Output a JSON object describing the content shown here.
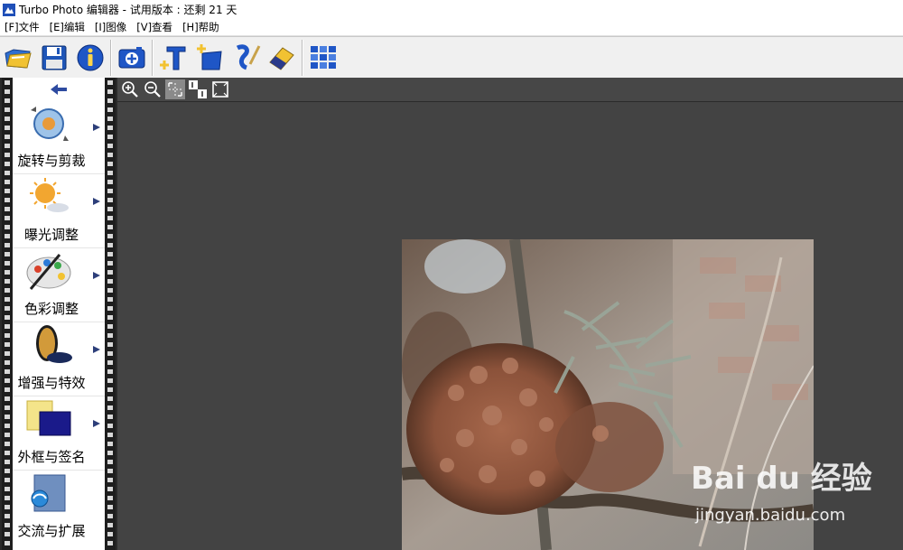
{
  "window": {
    "title": "Turbo Photo 编辑器 - 试用版本 : 还剩 21 天"
  },
  "menu": {
    "items": [
      {
        "label": "[F]文件"
      },
      {
        "label": "[E]编辑"
      },
      {
        "label": "[I]图像"
      },
      {
        "label": "[V]查看"
      },
      {
        "label": "[H]帮助"
      }
    ]
  },
  "toolbar": {
    "buttons": [
      {
        "icon": "open-folder-icon"
      },
      {
        "icon": "save-disk-icon"
      },
      {
        "icon": "info-icon"
      },
      {
        "icon": "add-photo-icon"
      },
      {
        "icon": "add-text-icon"
      },
      {
        "icon": "add-frame-icon"
      },
      {
        "icon": "brush-icon"
      },
      {
        "icon": "eraser-icon"
      },
      {
        "icon": "batch-grid-icon"
      }
    ]
  },
  "sidebar": {
    "back_icon": "back-arrow-icon",
    "tools": [
      {
        "label": "旋转与剪裁",
        "icon": "rotate-crop-icon",
        "has_submenu": true
      },
      {
        "label": "曝光调整",
        "icon": "exposure-sun-icon",
        "has_submenu": true
      },
      {
        "label": "色彩调整",
        "icon": "color-palette-icon",
        "has_submenu": true
      },
      {
        "label": "增强与特效",
        "icon": "lens-filter-icon",
        "has_submenu": true
      },
      {
        "label": "外框与签名",
        "icon": "frame-signature-icon",
        "has_submenu": true
      },
      {
        "label": "交流与扩展",
        "icon": "share-extend-icon",
        "has_submenu": false
      }
    ]
  },
  "canvas_toolbar": {
    "buttons": [
      {
        "icon": "zoom-in-icon"
      },
      {
        "icon": "zoom-out-icon"
      },
      {
        "icon": "fit-window-icon"
      },
      {
        "icon": "actual-size-icon"
      },
      {
        "icon": "fullscreen-icon"
      }
    ]
  },
  "watermark": {
    "logo": "Bai du 经验",
    "url": "jingyan.baidu.com"
  },
  "colors": {
    "canvas_bg": "#434343",
    "canvas_toolbar_bg": "#474747",
    "toolbar_bg": "#f0f0f0",
    "accent_blue": "#1a4fb4"
  }
}
